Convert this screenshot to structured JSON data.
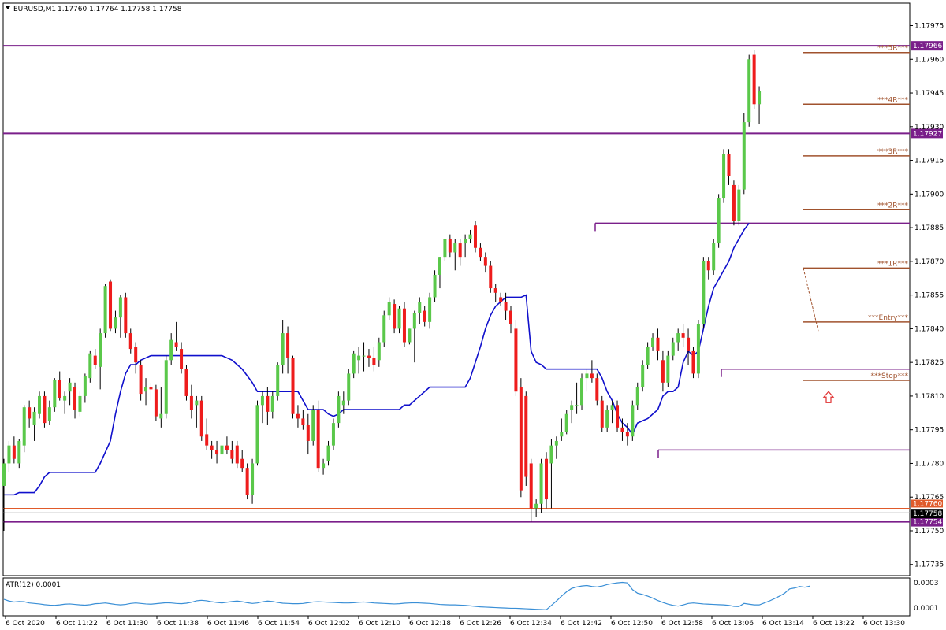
{
  "header": {
    "symbol": "EURUSD,M1",
    "ohlc": "1.17760 1.17764 1.17758 1.17758"
  },
  "indicator": {
    "label": "ATR(12) 0.0001",
    "scale_top": "0.0003",
    "scale_bottom": "0.0001"
  },
  "colors": {
    "bull": "#5ac84a",
    "bear": "#ee1c1c",
    "bull_dark": "#1f6f1f",
    "bear_dark": "#a01010",
    "stop_line": "#1010cc",
    "resistance": "#7a1f8a",
    "level": "#a0522d",
    "atr": "#3a8fd6",
    "bid_line": "#e05a2a",
    "grid": "#000000"
  },
  "chart_data": {
    "type": "candlestick",
    "symbol": "EURUSD",
    "timeframe": "M1",
    "ylim": [
      1.1773,
      1.17985
    ],
    "yticks": [
      "1.17975",
      "1.17960",
      "1.17945",
      "1.17930",
      "1.17915",
      "1.17900",
      "1.17885",
      "1.17870",
      "1.17855",
      "1.17840",
      "1.17825",
      "1.17810",
      "1.17795",
      "1.17780",
      "1.17765",
      "1.17750",
      "1.17735"
    ],
    "xticks": [
      "6 Oct 2020",
      "6 Oct 11:22",
      "6 Oct 11:30",
      "6 Oct 11:38",
      "6 Oct 11:46",
      "6 Oct 11:54",
      "6 Oct 12:02",
      "6 Oct 12:10",
      "6 Oct 12:18",
      "6 Oct 12:26",
      "6 Oct 12:34",
      "6 Oct 12:42",
      "6 Oct 12:50",
      "6 Oct 12:58",
      "6 Oct 13:06",
      "6 Oct 13:14",
      "6 Oct 13:22",
      "6 Oct 13:30"
    ],
    "candles": [
      [
        1.1777,
        1.17782,
        1.1775,
        1.1778
      ],
      [
        1.1778,
        1.1779,
        1.17776,
        1.17788
      ],
      [
        1.17788,
        1.17792,
        1.1778,
        1.17782
      ],
      [
        1.1778,
        1.17791,
        1.17778,
        1.1779
      ],
      [
        1.17788,
        1.17806,
        1.17785,
        1.17805
      ],
      [
        1.17805,
        1.17808,
        1.17796,
        1.178
      ],
      [
        1.17797,
        1.17805,
        1.1779,
        1.17803
      ],
      [
        1.17802,
        1.17812,
        1.178,
        1.1781
      ],
      [
        1.1781,
        1.17812,
        1.17796,
        1.17798
      ],
      [
        1.17799,
        1.17808,
        1.17797,
        1.17805
      ],
      [
        1.17805,
        1.17818,
        1.17803,
        1.17817
      ],
      [
        1.17817,
        1.17821,
        1.17808,
        1.17809
      ],
      [
        1.17808,
        1.17812,
        1.17802,
        1.1781
      ],
      [
        1.17812,
        1.17818,
        1.17806,
        1.17816
      ],
      [
        1.17814,
        1.17816,
        1.178,
        1.17804
      ],
      [
        1.17803,
        1.17812,
        1.17801,
        1.1781
      ],
      [
        1.1781,
        1.1782,
        1.17807,
        1.17819
      ],
      [
        1.17818,
        1.1783,
        1.17816,
        1.17829
      ],
      [
        1.17828,
        1.17831,
        1.17822,
        1.17824
      ],
      [
        1.17823,
        1.1784,
        1.17813,
        1.17838
      ],
      [
        1.17838,
        1.1786,
        1.17836,
        1.17859
      ],
      [
        1.17861,
        1.17862,
        1.17839,
        1.1784
      ],
      [
        1.1784,
        1.17848,
        1.17838,
        1.17845
      ],
      [
        1.17845,
        1.17855,
        1.17836,
        1.17854
      ],
      [
        1.17854,
        1.17856,
        1.17836,
        1.17838
      ],
      [
        1.17838,
        1.1784,
        1.17829,
        1.17831
      ],
      [
        1.17832,
        1.17834,
        1.1782,
        1.17825
      ],
      [
        1.17824,
        1.17826,
        1.17808,
        1.17811
      ],
      [
        1.17812,
        1.17818,
        1.17806,
        1.17814
      ],
      [
        1.17814,
        1.17816,
        1.17808,
        1.17813
      ],
      [
        1.17813,
        1.17815,
        1.17799,
        1.17801
      ],
      [
        1.178,
        1.17814,
        1.17796,
        1.17802
      ],
      [
        1.17802,
        1.17828,
        1.178,
        1.17826
      ],
      [
        1.17826,
        1.17838,
        1.17824,
        1.17835
      ],
      [
        1.17834,
        1.17843,
        1.1783,
        1.17832
      ],
      [
        1.17831,
        1.17834,
        1.1782,
        1.17822
      ],
      [
        1.17822,
        1.17824,
        1.17808,
        1.1781
      ],
      [
        1.1781,
        1.17815,
        1.178,
        1.17804
      ],
      [
        1.17806,
        1.1781,
        1.17796,
        1.17808
      ],
      [
        1.17808,
        1.1781,
        1.1779,
        1.17792
      ],
      [
        1.17793,
        1.178,
        1.17786,
        1.17788
      ],
      [
        1.17788,
        1.1779,
        1.17782,
        1.17786
      ],
      [
        1.17786,
        1.1779,
        1.1778,
        1.17784
      ],
      [
        1.17784,
        1.1779,
        1.17778,
        1.17788
      ],
      [
        1.17788,
        1.17792,
        1.17784,
        1.17786
      ],
      [
        1.17786,
        1.1779,
        1.1778,
        1.17782
      ],
      [
        1.17788,
        1.1779,
        1.17778,
        1.1778
      ],
      [
        1.17782,
        1.17786,
        1.17776,
        1.17778
      ],
      [
        1.17778,
        1.1778,
        1.17764,
        1.17766
      ],
      [
        1.17766,
        1.17782,
        1.17762,
        1.1778
      ],
      [
        1.1778,
        1.17808,
        1.17779,
        1.17806
      ],
      [
        1.17806,
        1.17812,
        1.17798,
        1.1781
      ],
      [
        1.1781,
        1.17814,
        1.17797,
        1.17803
      ],
      [
        1.17803,
        1.17812,
        1.178,
        1.1781
      ],
      [
        1.1781,
        1.17825,
        1.17808,
        1.17824
      ],
      [
        1.17824,
        1.17844,
        1.1782,
        1.17838
      ],
      [
        1.17838,
        1.17841,
        1.1782,
        1.17827
      ],
      [
        1.17827,
        1.17828,
        1.178,
        1.17802
      ],
      [
        1.17802,
        1.17806,
        1.17796,
        1.178
      ],
      [
        1.178,
        1.17804,
        1.17795,
        1.17797
      ],
      [
        1.17797,
        1.17802,
        1.17784,
        1.1779
      ],
      [
        1.1779,
        1.17806,
        1.17788,
        1.17804
      ],
      [
        1.17804,
        1.17808,
        1.17776,
        1.17778
      ],
      [
        1.17778,
        1.17782,
        1.17775,
        1.1778
      ],
      [
        1.17781,
        1.1779,
        1.17779,
        1.17788
      ],
      [
        1.17788,
        1.178,
        1.17786,
        1.17798
      ],
      [
        1.17798,
        1.17812,
        1.17796,
        1.1781
      ],
      [
        1.17806,
        1.17812,
        1.17802,
        1.17808
      ],
      [
        1.17808,
        1.17822,
        1.17806,
        1.1782
      ],
      [
        1.1782,
        1.1783,
        1.17818,
        1.17829
      ],
      [
        1.17826,
        1.17832,
        1.1782,
        1.17828
      ],
      [
        1.17828,
        1.17834,
        1.17821,
        1.17828
      ],
      [
        1.17828,
        1.17831,
        1.17823,
        1.17827
      ],
      [
        1.17827,
        1.17832,
        1.17821,
        1.17824
      ],
      [
        1.17826,
        1.17836,
        1.17823,
        1.17834
      ],
      [
        1.17834,
        1.17848,
        1.17832,
        1.17846
      ],
      [
        1.17846,
        1.17854,
        1.17844,
        1.17852
      ],
      [
        1.17851,
        1.17853,
        1.17838,
        1.1784
      ],
      [
        1.1784,
        1.1785,
        1.17838,
        1.17849
      ],
      [
        1.17849,
        1.17852,
        1.17832,
        1.17834
      ],
      [
        1.17834,
        1.1784,
        1.17833,
        1.1784
      ],
      [
        1.1784,
        1.17848,
        1.17825,
        1.17847
      ],
      [
        1.17847,
        1.17854,
        1.17842,
        1.17852
      ],
      [
        1.17848,
        1.1785,
        1.17841,
        1.17843
      ],
      [
        1.17843,
        1.17856,
        1.1784,
        1.17854
      ],
      [
        1.17854,
        1.17866,
        1.17852,
        1.17864
      ],
      [
        1.17864,
        1.17872,
        1.17858,
        1.17872
      ],
      [
        1.17872,
        1.1788,
        1.1787,
        1.1788
      ],
      [
        1.1788,
        1.17882,
        1.17872,
        1.17874
      ],
      [
        1.17874,
        1.1788,
        1.17866,
        1.17878
      ],
      [
        1.17878,
        1.1788,
        1.17868,
        1.17872
      ],
      [
        1.17878,
        1.17882,
        1.17872,
        1.1788
      ],
      [
        1.1788,
        1.17884,
        1.17878,
        1.17882
      ],
      [
        1.17886,
        1.17888,
        1.17874,
        1.17876
      ],
      [
        1.17876,
        1.17878,
        1.1787,
        1.17872
      ],
      [
        1.17872,
        1.17874,
        1.17865,
        1.17868
      ],
      [
        1.17868,
        1.1787,
        1.17856,
        1.17858
      ],
      [
        1.17858,
        1.1786,
        1.17852,
        1.17856
      ],
      [
        1.17854,
        1.17856,
        1.1785,
        1.17852
      ],
      [
        1.17852,
        1.17856,
        1.17844,
        1.17848
      ],
      [
        1.17848,
        1.1785,
        1.17838,
        1.17842
      ],
      [
        1.1784,
        1.17844,
        1.1781,
        1.17812
      ],
      [
        1.17814,
        1.17818,
        1.17765,
        1.17768
      ],
      [
        1.1781,
        1.17812,
        1.1777,
        1.17774
      ],
      [
        1.1778,
        1.17782,
        1.17754,
        1.1776
      ],
      [
        1.1776,
        1.17764,
        1.17756,
        1.17762
      ],
      [
        1.17762,
        1.17782,
        1.17758,
        1.1778
      ],
      [
        1.17782,
        1.17785,
        1.1776,
        1.17764
      ],
      [
        1.1778,
        1.17791,
        1.1776,
        1.17788
      ],
      [
        1.17788,
        1.17792,
        1.17782,
        1.1779
      ],
      [
        1.17792,
        1.178,
        1.1779,
        1.17794
      ],
      [
        1.17794,
        1.17804,
        1.17793,
        1.17802
      ],
      [
        1.17804,
        1.17808,
        1.17798,
        1.17806
      ],
      [
        1.17806,
        1.17816,
        1.17802,
        1.17806
      ],
      [
        1.17806,
        1.1782,
        1.17804,
        1.17818
      ],
      [
        1.17818,
        1.17822,
        1.17812,
        1.1782
      ],
      [
        1.1782,
        1.17826,
        1.17816,
        1.17818
      ],
      [
        1.17818,
        1.1782,
        1.17806,
        1.17808
      ],
      [
        1.17808,
        1.1781,
        1.17794,
        1.17796
      ],
      [
        1.17796,
        1.17806,
        1.17794,
        1.17804
      ],
      [
        1.17804,
        1.17808,
        1.17798,
        1.17806
      ],
      [
        1.17806,
        1.17808,
        1.17794,
        1.17796
      ],
      [
        1.17796,
        1.178,
        1.1779,
        1.17794
      ],
      [
        1.17794,
        1.17798,
        1.17788,
        1.17792
      ],
      [
        1.17792,
        1.17808,
        1.1779,
        1.17806
      ],
      [
        1.17806,
        1.17816,
        1.17804,
        1.17814
      ],
      [
        1.17814,
        1.17826,
        1.17812,
        1.17824
      ],
      [
        1.17824,
        1.17834,
        1.17822,
        1.17832
      ],
      [
        1.17832,
        1.17838,
        1.1783,
        1.17836
      ],
      [
        1.17836,
        1.1784,
        1.17826,
        1.1783
      ],
      [
        1.17826,
        1.1783,
        1.17812,
        1.17816
      ],
      [
        1.17816,
        1.1783,
        1.17814,
        1.17828
      ],
      [
        1.17828,
        1.17836,
        1.17826,
        1.17834
      ],
      [
        1.17834,
        1.1784,
        1.1783,
        1.17838
      ],
      [
        1.17838,
        1.17842,
        1.17832,
        1.17836
      ],
      [
        1.17836,
        1.1784,
        1.17824,
        1.1783
      ],
      [
        1.1783,
        1.17832,
        1.17818,
        1.1782
      ],
      [
        1.1782,
        1.17844,
        1.17818,
        1.17842
      ],
      [
        1.17842,
        1.17872,
        1.1784,
        1.1787
      ],
      [
        1.1787,
        1.17872,
        1.17862,
        1.17866
      ],
      [
        1.17866,
        1.1788,
        1.17864,
        1.17878
      ],
      [
        1.17878,
        1.179,
        1.17876,
        1.17898
      ],
      [
        1.17898,
        1.1792,
        1.17896,
        1.17918
      ],
      [
        1.17918,
        1.1792,
        1.17904,
        1.17908
      ],
      [
        1.17904,
        1.17906,
        1.17886,
        1.17888
      ],
      [
        1.17888,
        1.17904,
        1.17886,
        1.17902
      ],
      [
        1.17902,
        1.17936,
        1.179,
        1.17932
      ],
      [
        1.17932,
        1.17962,
        1.1793,
        1.1796
      ],
      [
        1.17962,
        1.17964,
        1.17938,
        1.1794
      ],
      [
        1.1794,
        1.17948,
        1.17931,
        1.17946
      ]
    ],
    "trailing_stop": [
      1.17766,
      1.17766,
      1.17766,
      1.17767,
      1.17767,
      1.17767,
      1.17767,
      1.1777,
      1.17774,
      1.17776,
      1.17776,
      1.17776,
      1.17776,
      1.17776,
      1.17776,
      1.17776,
      1.17776,
      1.17776,
      1.17776,
      1.1778,
      1.17785,
      1.1779,
      1.17802,
      1.17812,
      1.1782,
      1.17824,
      1.17824,
      1.17826,
      1.17827,
      1.17828,
      1.17828,
      1.17828,
      1.17828,
      1.17828,
      1.17828,
      1.17828,
      1.17828,
      1.17828,
      1.17828,
      1.17828,
      1.17828,
      1.17828,
      1.17828,
      1.17828,
      1.17827,
      1.17826,
      1.17824,
      1.17822,
      1.17819,
      1.17816,
      1.17812,
      1.17812,
      1.17812,
      1.17812,
      1.17812,
      1.17812,
      1.17812,
      1.17812,
      1.17812,
      1.17808,
      1.17804,
      1.17804,
      1.17804,
      1.17804,
      1.17802,
      1.17801,
      1.17802,
      1.17804,
      1.17804,
      1.17804,
      1.17804,
      1.17804,
      1.17804,
      1.17804,
      1.17804,
      1.17804,
      1.17804,
      1.17804,
      1.17804,
      1.17806,
      1.17806,
      1.17808,
      1.1781,
      1.17812,
      1.17814,
      1.17814,
      1.17814,
      1.17814,
      1.17814,
      1.17814,
      1.17814,
      1.17814,
      1.17818,
      1.17825,
      1.17832,
      1.1784,
      1.17846,
      1.1785,
      1.17852,
      1.17854,
      1.17854,
      1.17854,
      1.17854,
      1.17855,
      1.1783,
      1.17825,
      1.17824,
      1.17822,
      1.17822,
      1.17822,
      1.17822,
      1.17822,
      1.17822,
      1.17822,
      1.17822,
      1.17822,
      1.17822,
      1.17822,
      1.17818,
      1.17812,
      1.17808,
      1.17802,
      1.17798,
      1.17796,
      1.17793,
      1.17798,
      1.17799,
      1.178,
      1.17802,
      1.17804,
      1.1781,
      1.17812,
      1.17812,
      1.17814,
      1.17825,
      1.1783,
      1.17828,
      1.1783,
      1.1784,
      1.1785,
      1.17858,
      1.17862,
      1.17866,
      1.1787,
      1.17876,
      1.1788,
      1.17884,
      1.17887
    ],
    "atr": [
      0.000135,
      0.000128,
      0.000124,
      0.000126,
      0.000125,
      0.00012,
      0.000118,
      0.000116,
      0.000113,
      0.000111,
      0.00011,
      0.000112,
      0.000115,
      0.000116,
      0.000114,
      0.000112,
      0.000111,
      0.000113,
      0.000117,
      0.000118,
      0.00012,
      0.000117,
      0.000114,
      0.000112,
      0.000114,
      0.000118,
      0.00012,
      0.000118,
      0.000116,
      0.000115,
      0.000117,
      0.000119,
      0.000121,
      0.00012,
      0.000118,
      0.000117,
      0.000119,
      0.000123,
      0.000129,
      0.000131,
      0.000129,
      0.000125,
      0.000122,
      0.00012,
      0.000123,
      0.000126,
      0.000128,
      0.000125,
      0.000121,
      0.000118,
      0.00012,
      0.000125,
      0.000128,
      0.000126,
      0.000122,
      0.000119,
      0.000118,
      0.000117,
      0.000117,
      0.000118,
      0.000121,
      0.000124,
      0.000125,
      0.000124,
      0.000123,
      0.000122,
      0.000121,
      0.00012,
      0.00012,
      0.000121,
      0.000123,
      0.000124,
      0.000122,
      0.00012,
      0.000119,
      0.000118,
      0.000117,
      0.000116,
      0.000117,
      0.000119,
      0.00012,
      0.000121,
      0.00012,
      0.000119,
      0.000118,
      0.000116,
      0.000114,
      0.000113,
      0.000112,
      0.000112,
      0.000111,
      0.00011,
      0.000108,
      0.000106,
      0.000104,
      0.000103,
      0.000102,
      0.000101,
      0.0001,
      9.9e-05,
      9.8e-05,
      9.8e-05,
      9.7e-05,
      9.6e-05,
      9.5e-05,
      9.4e-05,
      9.3e-05,
      9.2e-05,
      0.00011,
      0.000128,
      0.000148,
      0.000166,
      0.00018,
      0.000186,
      0.00019,
      0.000192,
      0.000188,
      0.000186,
      0.00019,
      0.000196,
      0.0002,
      0.000203,
      0.000205,
      0.000203,
      0.000175,
      0.00016,
      0.000155,
      0.000148,
      0.00014,
      0.00013,
      0.000122,
      0.000115,
      0.00011,
      0.000107,
      0.000112,
      0.000118,
      0.00012,
      0.000118,
      0.000116,
      0.000115,
      0.000114,
      0.000113,
      0.000112,
      0.00011,
      0.000106,
      0.000105,
      0.000118,
      0.000115,
      0.000112,
      0.000112,
      0.00012,
      0.000128,
      0.000138,
      0.000148,
      0.00016,
      0.000178,
      0.000182,
      0.000188,
      0.000185,
      0.00019
    ],
    "horizontal_levels": [
      {
        "price": 1.17966,
        "tag": "1.17966"
      },
      {
        "price": 1.17927,
        "tag": "1.17927"
      },
      {
        "price": 1.17754,
        "tag": "1.17754"
      }
    ],
    "partial_levels": [
      1.17887,
      1.17822,
      1.17786
    ],
    "trade_levels": [
      {
        "label": "***5R***",
        "price": 1.17963
      },
      {
        "label": "***4R***",
        "price": 1.1794
      },
      {
        "label": "***3R***",
        "price": 1.17917
      },
      {
        "label": "***2R***",
        "price": 1.17893
      },
      {
        "label": "***1R***",
        "price": 1.17867
      },
      {
        "label": "***Entry***",
        "price": 1.17843
      },
      {
        "label": "***Stop***",
        "price": 1.17817
      }
    ],
    "bid": {
      "price": 1.17758,
      "tag": "1.17758"
    },
    "ask": {
      "price": 1.1776,
      "tag": "1.17760"
    }
  }
}
